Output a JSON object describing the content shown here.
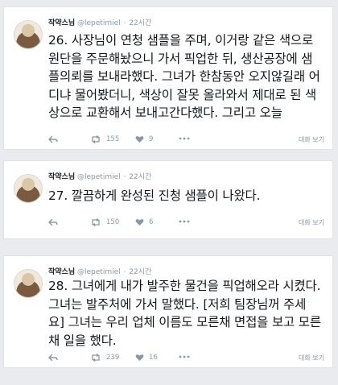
{
  "tweets": [
    {
      "name": "작약스님",
      "handle": "@lepetimiel",
      "time": "22시간",
      "text": "26. 사장님이 연청 샘플을 주며, 이거랑 같은 색으로 원단을 주문해놨으니 가서 픽업한 뒤, 생산공장에 샘플의뢰를 보내라했다. 그녀가 한참동안 오지않길래 어디냐 물어봤더니, 색상이 잘못 올라와서 제대로 된 색상으로 교환해서 보내고간다했다. 그리고 오늘",
      "retweets": "155",
      "likes": "9",
      "conversation": "대화 보기"
    },
    {
      "name": "작약스님",
      "handle": "@lepetimiel",
      "time": "22시간",
      "text": "27. 깔끔하게 완성된 진청 샘플이 나왔다.",
      "retweets": "150",
      "likes": "6",
      "conversation": "대화 보기"
    },
    {
      "name": "작약스님",
      "handle": "@lepetimiel",
      "time": "22시간",
      "text": "28. 그녀에게 내가 발주한 물건을 픽업해오라 시켰다. 그녀는 발주처에 가서 말했다. [저희 팀장님꺼 주세요] 그녀는 우리 업체 이름도 모른채 면접을 보고 모른채 일을 했다.",
      "retweets": "239",
      "likes": "16",
      "conversation": "대화 보기"
    }
  ],
  "icons": [
    "reply-icon",
    "retweet-icon",
    "like-icon",
    "more-icon"
  ],
  "colors": {
    "background": "#e9ebee",
    "card": "#ffffff",
    "text": "#14171a",
    "meta": "#8899a6"
  }
}
